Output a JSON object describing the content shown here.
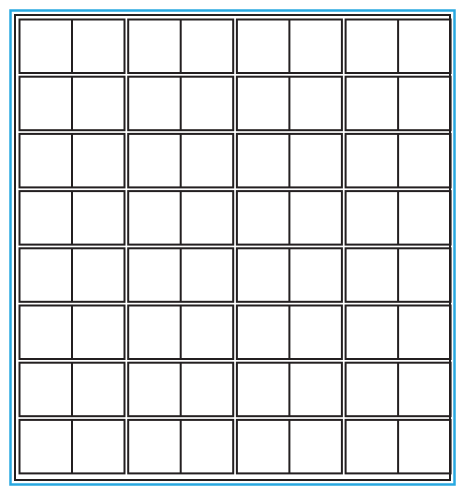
{
  "grid": {
    "rows": 8,
    "column_groups": 4,
    "cells_per_group": 2,
    "total_cells": 64
  },
  "colors": {
    "frame_outer": "#29a8e0",
    "line": "#231f20",
    "background": "#ffffff"
  }
}
